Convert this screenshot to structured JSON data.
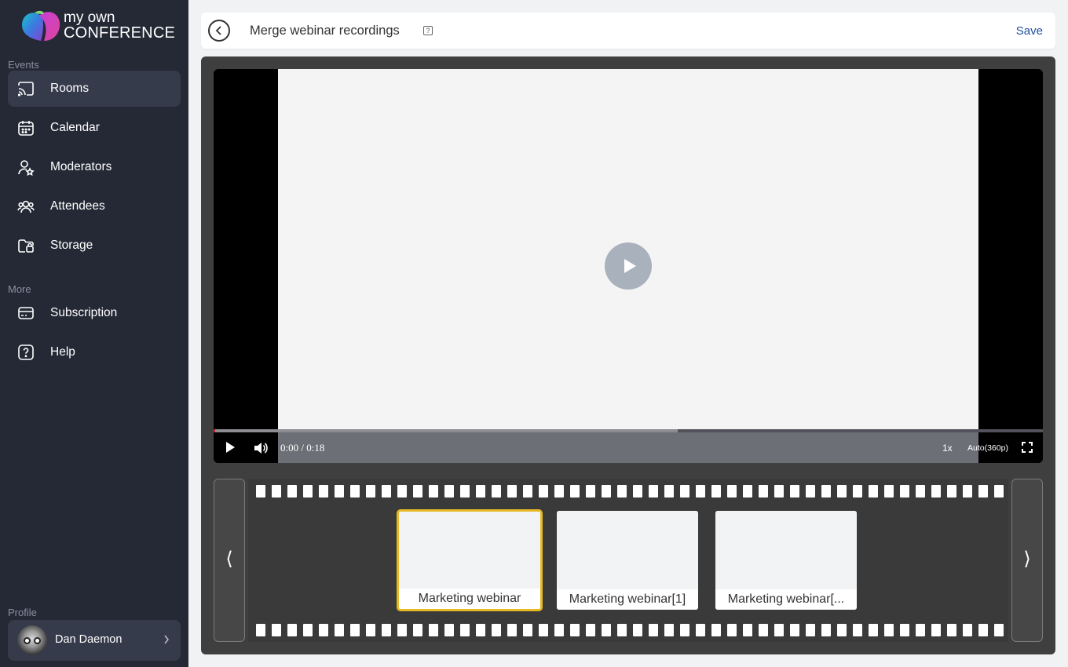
{
  "brand": {
    "line1": "my own",
    "line2": "CONFERENCE"
  },
  "sidebar": {
    "sections": [
      {
        "label": "Events"
      },
      {
        "label": "More"
      },
      {
        "label": "Profile"
      }
    ],
    "items": [
      {
        "label": "Rooms",
        "icon": "cast-icon",
        "active": true
      },
      {
        "label": "Calendar",
        "icon": "calendar-icon"
      },
      {
        "label": "Moderators",
        "icon": "moderator-icon"
      },
      {
        "label": "Attendees",
        "icon": "users-icon"
      },
      {
        "label": "Storage",
        "icon": "folder-icon"
      },
      {
        "label": "Subscription",
        "icon": "card-icon"
      },
      {
        "label": "Help",
        "icon": "help-icon"
      }
    ],
    "profile": {
      "name": "Dan Daemon"
    }
  },
  "header": {
    "title": "Merge webinar recordings",
    "help_glyph": "?",
    "save_label": "Save"
  },
  "player": {
    "current_time": "0:00",
    "separator": "/",
    "duration": "0:18",
    "played_fraction": 0.0,
    "buffered_fraction": 0.56,
    "speed": "1x",
    "quality": "Auto(360p)"
  },
  "filmstrip": {
    "prev_glyph": "⟨",
    "next_glyph": "⟩",
    "clips": [
      {
        "title": "Marketing webinar",
        "selected": true
      },
      {
        "title": "Marketing webinar[1]",
        "selected": false
      },
      {
        "title": "Marketing webinar[...",
        "selected": false
      }
    ]
  },
  "colors": {
    "sidebar_bg": "#252936",
    "active_item_bg": "#363b4b",
    "accent_link": "#1f4fa6",
    "selected_clip_border": "#e8b923",
    "progress_played": "#c1272d"
  }
}
